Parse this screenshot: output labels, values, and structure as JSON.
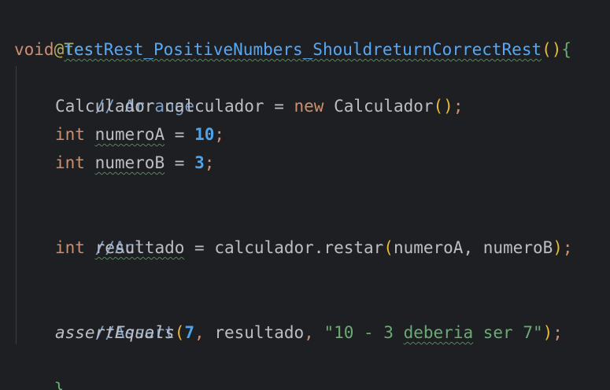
{
  "code": {
    "annotation": "@Test",
    "signature": {
      "void_kw": "void",
      "method_name": "testRest_PositiveNumbers_ShouldreturnCorrectRest",
      "parens": "()",
      "open_brace": "{"
    },
    "comment_arrange": "// Arrange",
    "line_calc": {
      "type": "Calculador",
      "var": "calculador",
      "eq": "=",
      "new_kw": "new",
      "ctor": "Calculador",
      "parens": "()",
      "semi": ";"
    },
    "line_a": {
      "type_kw": "int",
      "var": "numeroA",
      "eq": "=",
      "value": "10",
      "semi": ";"
    },
    "line_b": {
      "type_kw": "int",
      "var": "numeroB",
      "eq": "=",
      "value": "3",
      "semi": ";"
    },
    "comment_act": "//Act",
    "line_res": {
      "type_kw": "int",
      "var": "resultado",
      "eq": "=",
      "call": "calculador.restar",
      "open_paren": "(",
      "args": "numeroA, numeroB",
      "close_paren": ")",
      "semi": ";"
    },
    "comment_assert": "//Assert",
    "line_assert": {
      "fn": "assertEquals",
      "open_paren": "(",
      "expected": "7",
      "comma1": ",",
      "actual": "resultado",
      "comma2": ",",
      "str_q1": "\"10 - 3 ",
      "str_w": "deberia",
      "str_q2": " ser 7\"",
      "close_paren": ")",
      "semi": ";"
    },
    "close_brace": "}"
  }
}
